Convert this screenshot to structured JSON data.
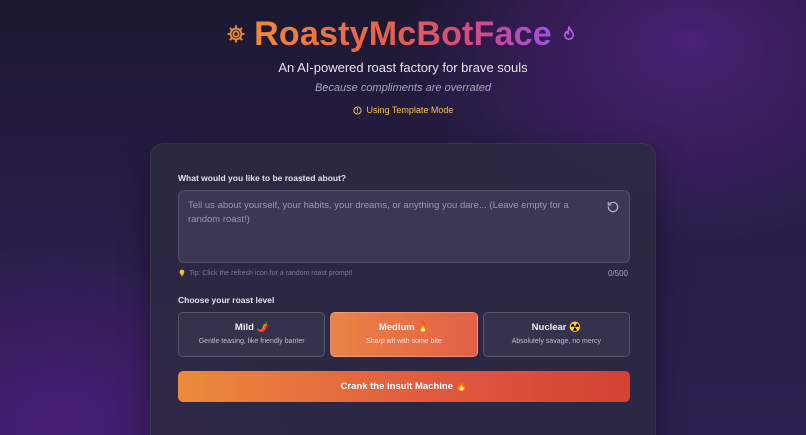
{
  "header": {
    "title": "RoastyMcBotFace",
    "subtitle": "An AI-powered roast factory for brave souls",
    "tagline": "Because compliments are overrated",
    "mode_label": "Using Template Mode"
  },
  "form": {
    "prompt_label": "What would you like to be roasted about?",
    "prompt_placeholder": "Tell us about yourself, your habits, your dreams, or anything you dare... (Leave empty for a random roast!)",
    "prompt_value": "",
    "tip": "Tip: Click the refresh icon for a random roast prompt!",
    "char_count": "0/500",
    "level_label": "Choose your roast level",
    "levels": [
      {
        "name": "Mild 🌶️",
        "desc": "Gentle teasing, like friendly banter",
        "selected": false
      },
      {
        "name": "Medium 🔥",
        "desc": "Sharp wit with some bite",
        "selected": true
      },
      {
        "name": "Nuclear ☢️",
        "desc": "Absolutely savage, no mercy",
        "selected": false
      }
    ],
    "submit_label": "Crank the Insult Machine 🔥"
  },
  "icons": {
    "title_left": "gear-icon",
    "title_right": "flame-icon",
    "mode": "info-icon",
    "refresh": "refresh-icon",
    "tip": "lightbulb-icon"
  },
  "colors": {
    "accent_orange": "#ec8a3c",
    "accent_red": "#d34234",
    "accent_purple": "#9f50e0",
    "mode_yellow": "#f2c14e"
  }
}
